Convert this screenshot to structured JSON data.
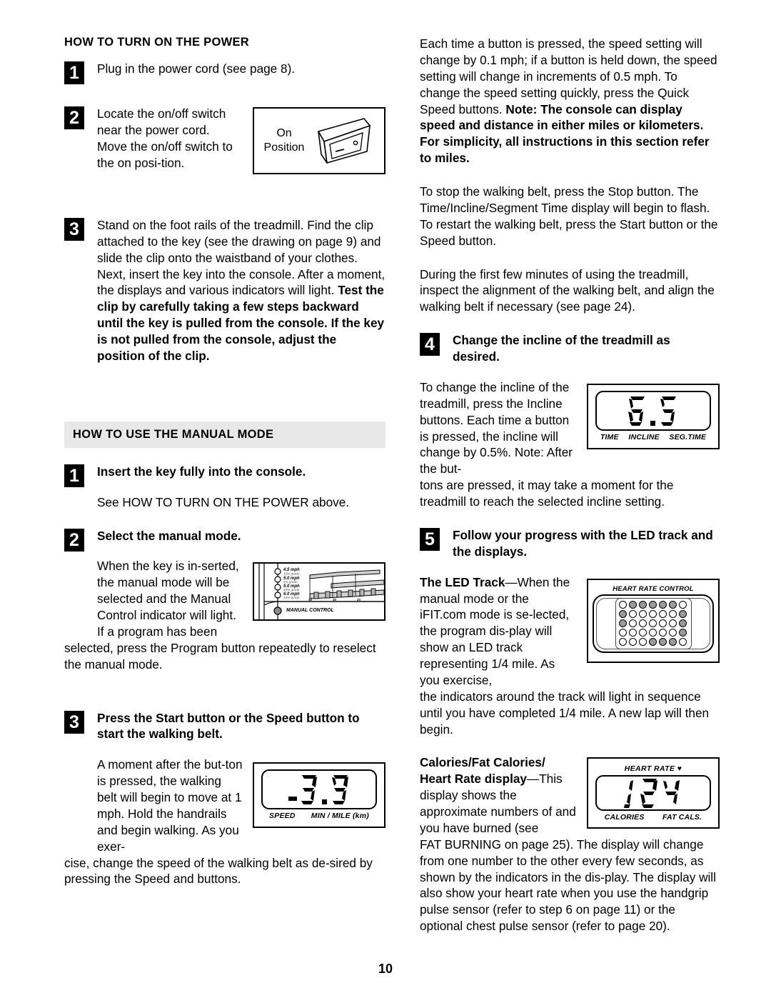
{
  "page": {
    "number": "10"
  },
  "left_column": {
    "section1": {
      "heading": "HOW TO TURN ON THE POWER",
      "steps": [
        {
          "num": "1",
          "text": "Plug in the power cord (see page 8)."
        },
        {
          "num": "2",
          "text": "Locate the on/off switch near the power cord. Move the on/off switch to the on posi-tion."
        },
        {
          "num": "3",
          "text_normal": "Stand on the foot rails of the treadmill. Find the clip attached to the key (see the drawing on page 9) and slide the clip onto the waistband of your clothes. Next, insert the key into the console. After a moment, the displays and various indicators will light. ",
          "text_bold": "Test the clip by carefully taking a few steps backward until the key is pulled from the console. If the key is not pulled from the console, adjust the position of the clip."
        }
      ],
      "switch_figure": {
        "label_line1": "On",
        "label_line2": "Position"
      }
    },
    "section2": {
      "heading": "HOW TO USE THE MANUAL MODE",
      "steps": [
        {
          "num": "1",
          "title": "Insert the key fully into the console.",
          "body": "See HOW TO TURN ON THE POWER above."
        },
        {
          "num": "2",
          "title": "Select the manual mode.",
          "body_wrap": "When the key is in-serted, the manual mode will be selected and the Manual Control indicator will light. If a program has been",
          "body_full": "selected, press the Program button repeatedly to reselect the manual mode."
        },
        {
          "num": "3",
          "title": "Press the Start button or the Speed    button to start the walking belt.",
          "body_wrap": "A moment after the but-ton is pressed, the walking belt will begin to move at 1 mph. Hold the handrails and begin walking. As you exer-",
          "body_full": "cise, change the speed of the walking belt as de-sired by pressing the Speed    and    buttons."
        }
      ],
      "console_figure": {
        "speed_labels": [
          {
            "speed": "4.5 mph",
            "grade": "10% grade"
          },
          {
            "speed": "5.0 mph",
            "grade": "5% grade"
          },
          {
            "speed": "5.0 mph",
            "grade": "10% grade"
          },
          {
            "speed": "6.0 mph",
            "grade": "10% grade"
          }
        ],
        "axis_ticks": [
          "40",
          "30",
          "20"
        ],
        "indicator_label": "MANUAL CONTROL"
      },
      "speed_display": {
        "value": "3.9",
        "label_left": "SPEED",
        "label_right": "MIN / MILE (km)"
      }
    }
  },
  "right_column": {
    "para_speed_normal": "Each time a button is pressed, the speed setting will change by 0.1 mph; if a button is held down, the speed setting will change in increments of 0.5 mph. To change the speed setting quickly, press the Quick Speed buttons. ",
    "para_speed_bold": "Note: The console can display speed and distance in either miles or kilometers. For simplicity, all instructions in this section refer to miles.",
    "para_stop": "To stop the walking belt, press the Stop button. The Time/Incline/Segment Time display will begin to flash. To restart the walking belt, press the Start button or the Speed    button.",
    "para_align": "During the first few minutes of using the treadmill, inspect the alignment of the walking belt, and align the walking belt if necessary (see page 24).",
    "step4": {
      "num": "4",
      "title": "Change the incline of the treadmill as desired.",
      "body_wrap": "To change the incline of the treadmill, press the Incline buttons. Each time a button is pressed, the incline will change by 0.5%. Note: After the but-",
      "body_full": "tons are pressed, it may take a moment for the treadmill to reach the selected incline setting."
    },
    "incline_display": {
      "value": "6.5",
      "labels": [
        "TIME",
        "INCLINE",
        "SEG.TIME"
      ]
    },
    "step5": {
      "num": "5",
      "title": "Follow your progress with the LED track and the displays.",
      "led_track_bold": "The LED Track",
      "led_track_normal": "—When the manual mode or the iFIT.com mode is se-lected, the program dis-play will show an LED track representing 1/4 mile. As you exercise,",
      "led_track_full": "the indicators around the track will light in sequence until you have completed 1/4 mile. A new lap will then begin.",
      "calories_bold_line1": "Calories/Fat Calories/",
      "calories_bold_line2": "Heart Rate display",
      "calories_normal_wrap": "—This display shows the approximate numbers of              and you have burned (see",
      "calories_full": "FAT BURNING on page 25). The display will change from one number to the other every few seconds, as shown by the indicators in the dis-play. The display will also show your heart rate when you use the handgrip pulse sensor (refer to step 6 on page 11) or the optional chest pulse sensor (refer to page 20)."
    },
    "led_track_figure": {
      "title": "HEART RATE CONTROL",
      "grid": [
        [
          0,
          1,
          1,
          1,
          1,
          1,
          0
        ],
        [
          1,
          0,
          0,
          0,
          0,
          0,
          1
        ],
        [
          1,
          0,
          0,
          0,
          0,
          0,
          1
        ],
        [
          0,
          0,
          0,
          0,
          0,
          0,
          1
        ],
        [
          0,
          0,
          0,
          1,
          1,
          1,
          0
        ]
      ]
    },
    "heart_rate_display": {
      "value": "124",
      "top_label": "HEART RATE",
      "label_left": "CALORIES",
      "label_right": "FAT CALS."
    }
  }
}
